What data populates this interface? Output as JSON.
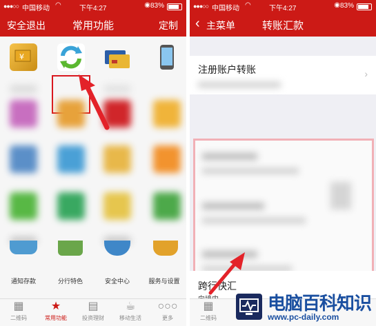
{
  "left": {
    "status": {
      "carrier": "中国移动",
      "time": "下午4:27",
      "battery": "83%"
    },
    "nav": {
      "left": "安全退出",
      "title": "常用功能",
      "right": "定制"
    },
    "bottom_labels": [
      "通知存款",
      "分行特色",
      "安全中心",
      "服务与设置"
    ],
    "tabs": [
      {
        "icon": "qr-code-icon",
        "label": "二维码"
      },
      {
        "icon": "star-icon",
        "label": "常用功能"
      },
      {
        "icon": "chart-icon",
        "label": "投资理财"
      },
      {
        "icon": "cup-icon",
        "label": "移动生活"
      },
      {
        "icon": "more-icon",
        "label": "更多"
      }
    ]
  },
  "right": {
    "status": {
      "carrier": "中国移动",
      "time": "下午4:27",
      "battery": "83%"
    },
    "nav": {
      "back": "主菜单",
      "title": "转账汇款"
    },
    "rows": {
      "registered": "注册账户转账",
      "cross_bank": "跨行快汇",
      "cross_bank_sub": "向境内"
    },
    "tab_first": "二维码"
  },
  "watermark": {
    "title": "电脑百科知识",
    "url": "www.pc-daily.com"
  },
  "colors": {
    "brand_red": "#cc1a16",
    "highlight": "#d9171e"
  }
}
